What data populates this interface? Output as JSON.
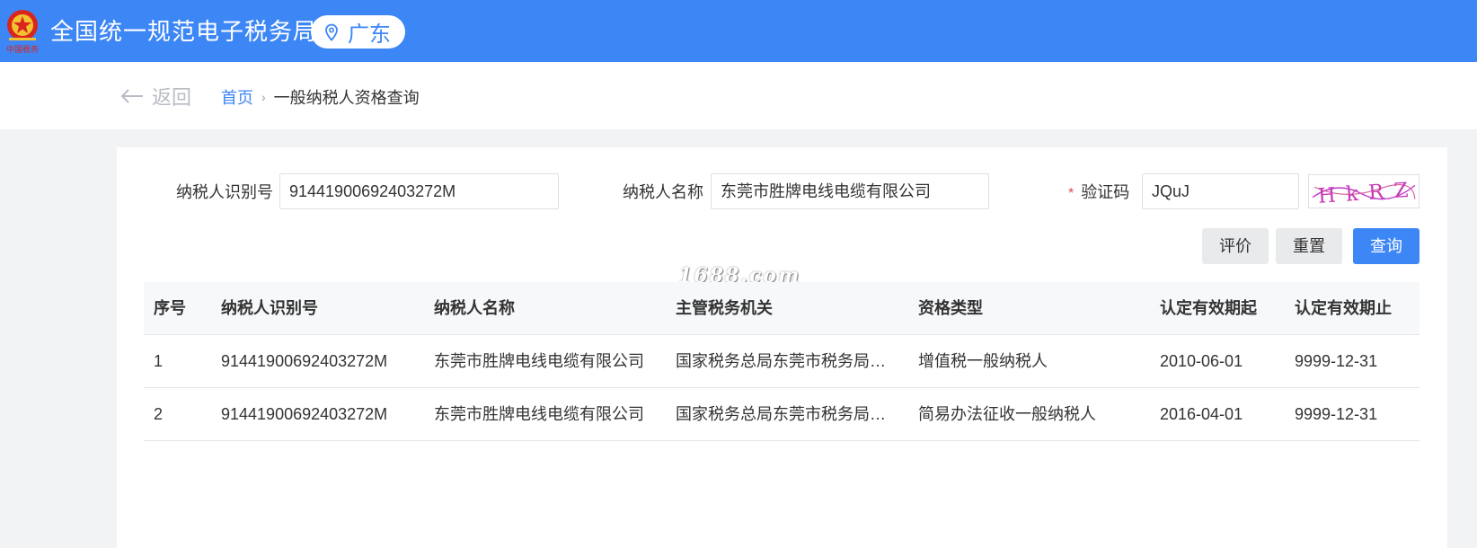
{
  "header": {
    "title": "全国统一规范电子税务局",
    "region": "广东",
    "emblem_text": "中国税务"
  },
  "nav": {
    "back_label": "返回",
    "breadcrumb_home": "首页",
    "breadcrumb_current": "一般纳税人资格查询"
  },
  "form": {
    "taxpayer_id_label": "纳税人识别号",
    "taxpayer_id_value": "91441900692403272M",
    "taxpayer_name_label": "纳税人名称",
    "taxpayer_name_value": "东莞市胜牌电线电缆有限公司",
    "captcha_required_mark": "*",
    "captcha_label": "验证码",
    "captcha_value": "JQuJ",
    "captcha_image_text": "HkRZ"
  },
  "buttons": {
    "evaluate": "评价",
    "reset": "重置",
    "query": "查询"
  },
  "watermark": "1688.com",
  "table": {
    "columns": [
      "序号",
      "纳税人识别号",
      "纳税人名称",
      "主管税务机关",
      "资格类型",
      "认定有效期起",
      "认定有效期止"
    ],
    "rows": [
      [
        "1",
        "91441900692403272M",
        "东莞市胜牌电线电缆有限公司",
        "国家税务总局东莞市税务局虎...",
        "增值税一般纳税人",
        "2010-06-01",
        "9999-12-31"
      ],
      [
        "2",
        "91441900692403272M",
        "东莞市胜牌电线电缆有限公司",
        "国家税务总局东莞市税务局虎...",
        "简易办法征收一般纳税人",
        "2016-04-01",
        "9999-12-31"
      ]
    ]
  },
  "colors": {
    "brand_blue": "#3d86f5",
    "required_red": "#e04b4b"
  }
}
